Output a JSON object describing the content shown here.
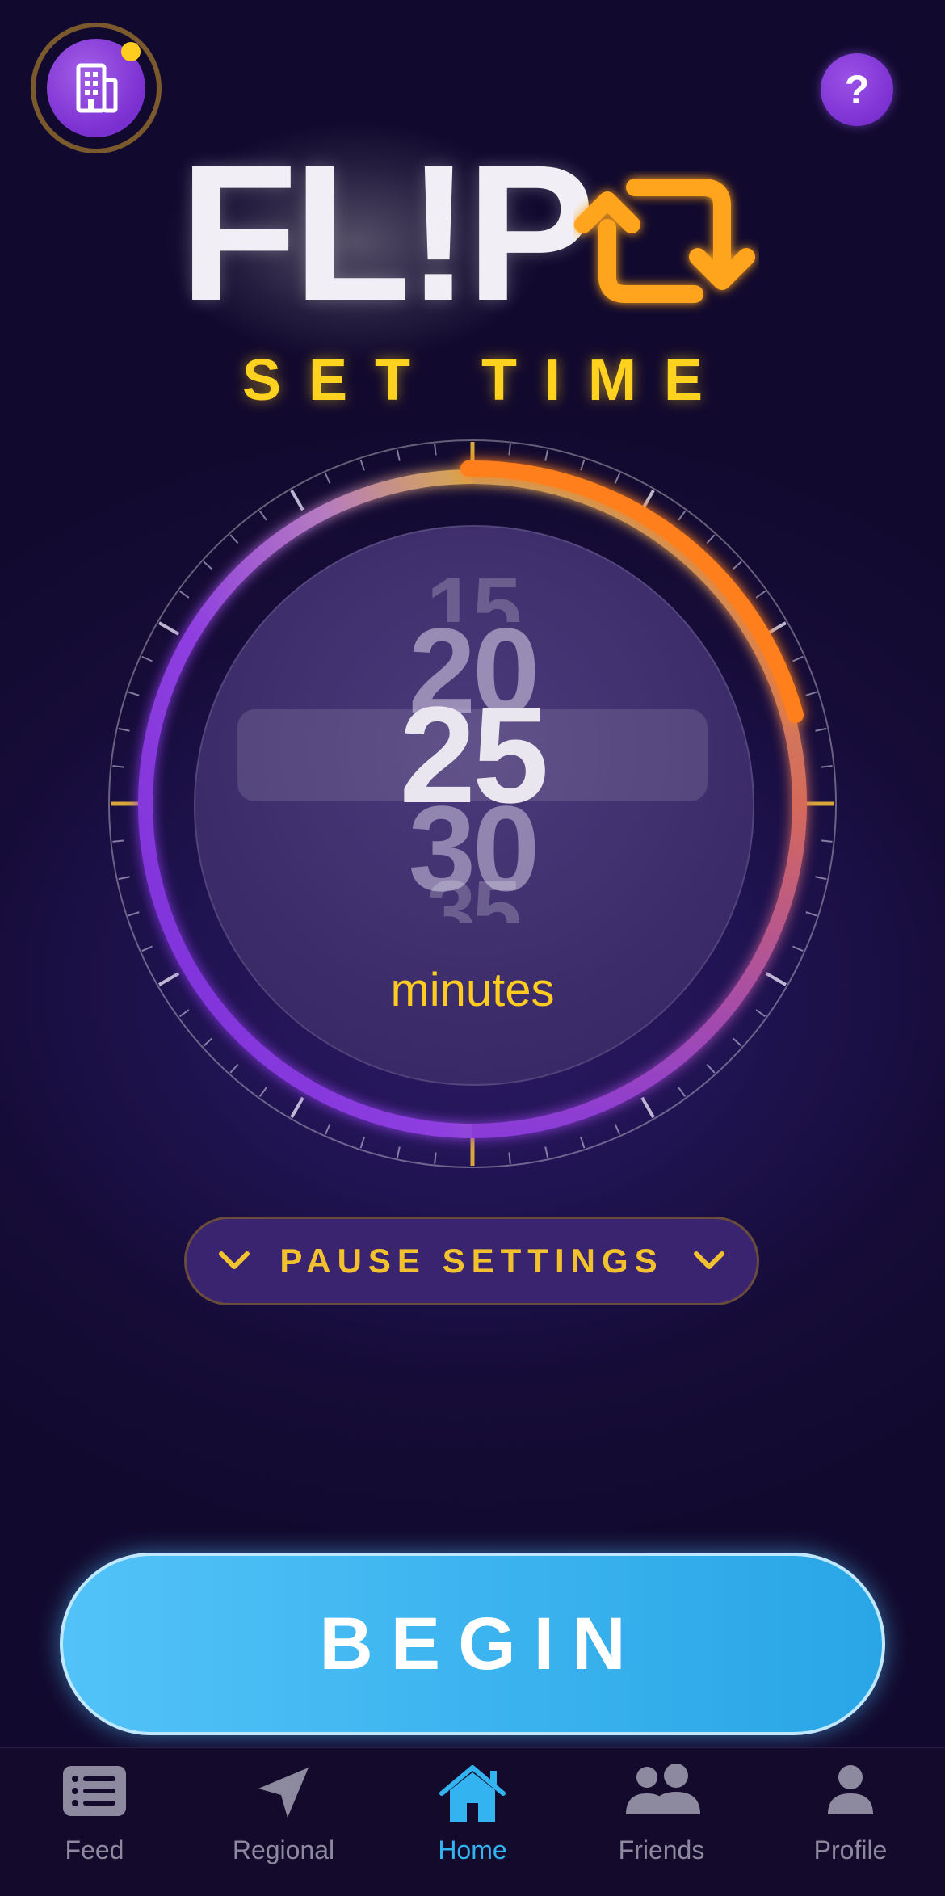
{
  "header": {
    "building_icon": "building-icon",
    "help_label": "?"
  },
  "logo": {
    "text": "FL!P",
    "icon": "repeat-arrows-icon"
  },
  "title": "SET TIME",
  "picker": {
    "values": [
      "15",
      "20",
      "25",
      "30",
      "35"
    ],
    "selected": "25",
    "unit": "minutes"
  },
  "pause_settings": {
    "label": "PAUSE SETTINGS"
  },
  "begin": {
    "label": "BEGIN"
  },
  "tabs": [
    {
      "label": "Feed",
      "icon": "list-icon"
    },
    {
      "label": "Regional",
      "icon": "location-arrow-icon"
    },
    {
      "label": "Home",
      "icon": "home-icon",
      "active": true
    },
    {
      "label": "Friends",
      "icon": "people-icon"
    },
    {
      "label": "Profile",
      "icon": "person-icon"
    }
  ],
  "colors": {
    "accent_yellow": "#ffd21f",
    "button_blue": "#3db4ef",
    "active_tab": "#33b3ef",
    "purple": "#7a2fd0",
    "orange": "#ff8a1a"
  }
}
